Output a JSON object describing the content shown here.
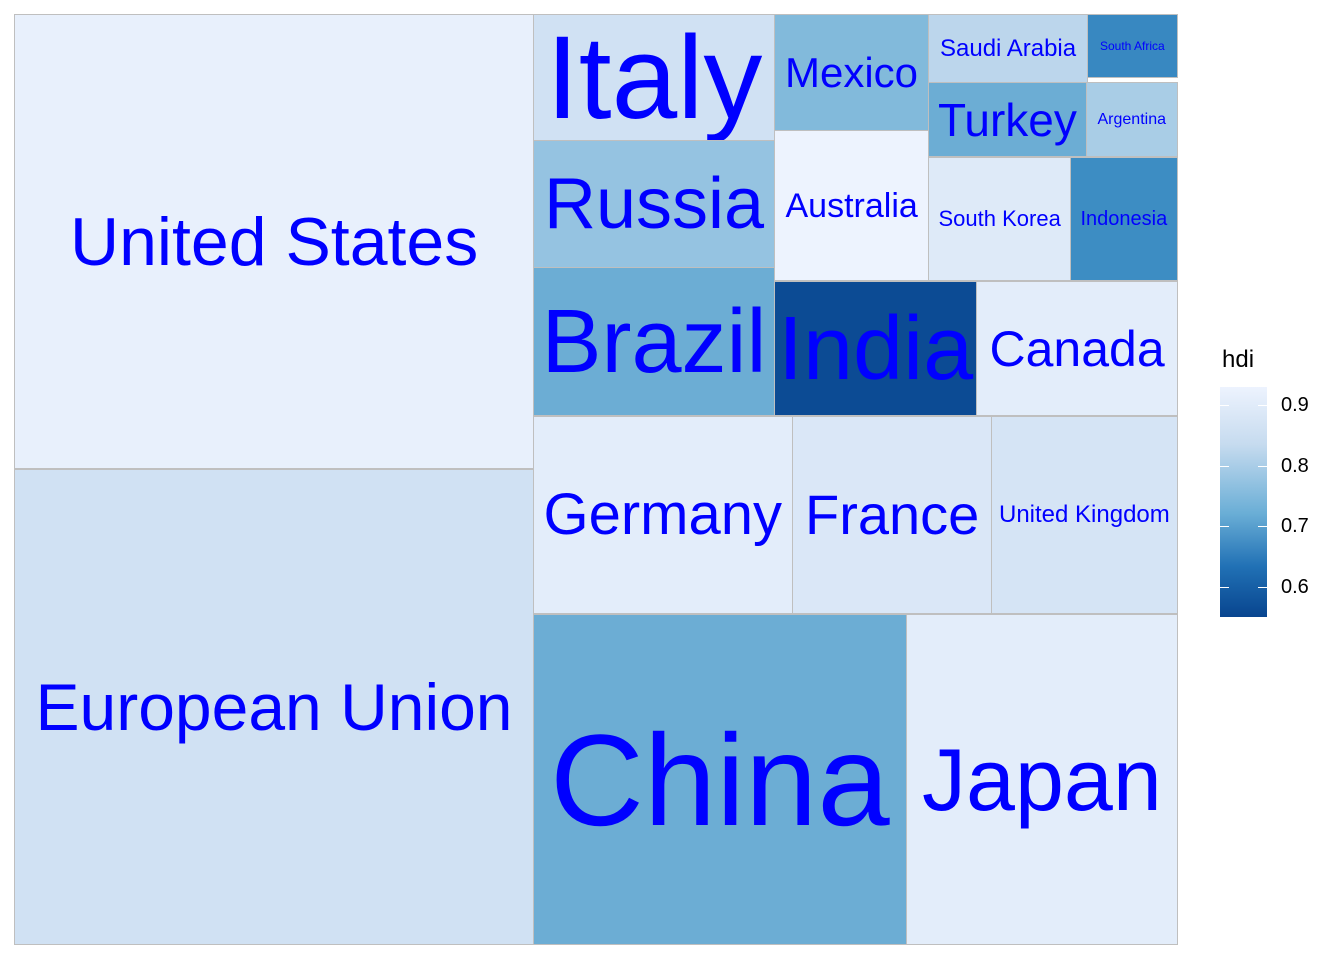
{
  "chart_data": {
    "type": "treemap",
    "legend": {
      "title": "hdi",
      "ticks": [
        0.9,
        0.8,
        0.7,
        0.6
      ],
      "range": [
        0.55,
        0.93
      ],
      "position": "right"
    },
    "colors": {
      "label": "#0000ff",
      "border": "#bfbfbf",
      "low": "#08458f",
      "high": "#edf3fe"
    },
    "items": [
      {
        "name": "United States",
        "value": 21.0,
        "hdi": 0.92
      },
      {
        "name": "European Union",
        "value": 19.0,
        "hdi": 0.87
      },
      {
        "name": "China",
        "value": 14.0,
        "hdi": 0.75
      },
      {
        "name": "Japan",
        "value": 5.1,
        "hdi": 0.91
      },
      {
        "name": "Germany",
        "value": 4.0,
        "hdi": 0.91
      },
      {
        "name": "France",
        "value": 3.0,
        "hdi": 0.89
      },
      {
        "name": "United Kingdom",
        "value": 2.8,
        "hdi": 0.88
      },
      {
        "name": "Italy",
        "value": 2.3,
        "hdi": 0.87
      },
      {
        "name": "Brazil",
        "value": 2.2,
        "hdi": 0.75
      },
      {
        "name": "India",
        "value": 2.0,
        "hdi": 0.56
      },
      {
        "name": "Canada",
        "value": 1.6,
        "hdi": 0.91
      },
      {
        "name": "Russia",
        "value": 1.9,
        "hdi": 0.8
      },
      {
        "name": "Australia",
        "value": 1.4,
        "hdi": 0.93
      },
      {
        "name": "Mexico",
        "value": 1.3,
        "hdi": 0.78
      },
      {
        "name": "South Korea",
        "value": 1.1,
        "hdi": 0.9
      },
      {
        "name": "Indonesia",
        "value": 0.9,
        "hdi": 0.68
      },
      {
        "name": "Turkey",
        "value": 0.8,
        "hdi": 0.75
      },
      {
        "name": "Saudi Arabia",
        "value": 0.7,
        "hdi": 0.84
      },
      {
        "name": "Argentina",
        "value": 0.6,
        "hdi": 0.82
      },
      {
        "name": "South Africa",
        "value": 0.4,
        "hdi": 0.67
      }
    ]
  }
}
